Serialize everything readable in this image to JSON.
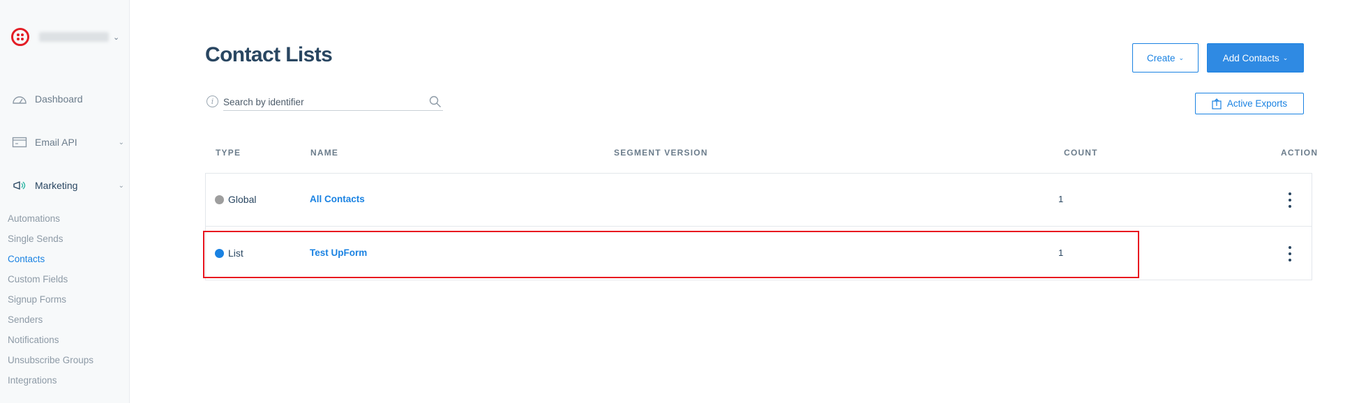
{
  "sidebar": {
    "main_nav": [
      {
        "label": "Dashboard",
        "icon": "gauge-icon"
      },
      {
        "label": "Email API",
        "icon": "email-api-icon"
      },
      {
        "label": "Marketing",
        "icon": "megaphone-icon"
      }
    ],
    "sub_items": [
      {
        "label": "Automations"
      },
      {
        "label": "Single Sends"
      },
      {
        "label": "Contacts"
      },
      {
        "label": "Custom Fields"
      },
      {
        "label": "Signup Forms"
      },
      {
        "label": "Senders"
      },
      {
        "label": "Notifications"
      },
      {
        "label": "Unsubscribe Groups"
      },
      {
        "label": "Integrations"
      }
    ],
    "active_sub": "Contacts"
  },
  "header": {
    "title": "Contact Lists",
    "create_label": "Create",
    "add_contacts_label": "Add Contacts",
    "active_exports_label": "Active Exports"
  },
  "search": {
    "placeholder": "Search by identifier",
    "value": ""
  },
  "table": {
    "columns": [
      "TYPE",
      "NAME",
      "SEGMENT VERSION",
      "COUNT",
      "ACTION"
    ],
    "rows": [
      {
        "type": "Global",
        "type_color": "#9e9e9e",
        "name": "All Contacts",
        "segment_version": "",
        "count": "1"
      },
      {
        "type": "List",
        "type_color": "#1a82e2",
        "name": "Test UpForm",
        "segment_version": "",
        "count": "1"
      }
    ]
  },
  "colors": {
    "accent": "#1a82e2",
    "brand": "#e31e26",
    "highlight": "#e8141f"
  }
}
